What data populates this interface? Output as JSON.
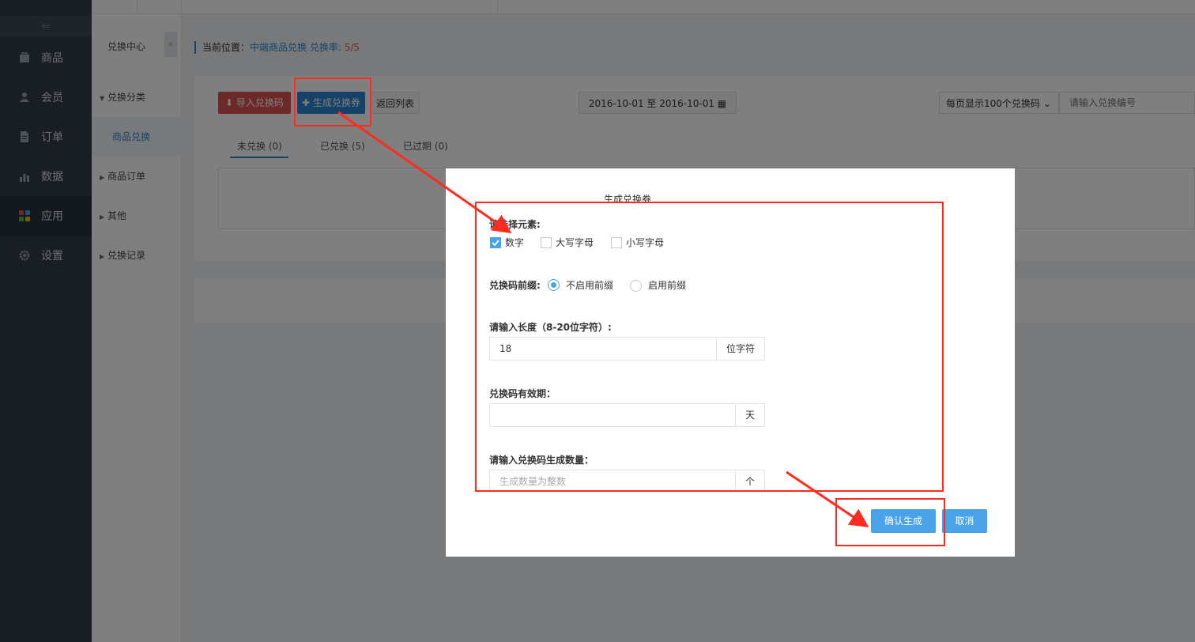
{
  "sidebar": {
    "toggle_glyph": "⇐",
    "items": [
      {
        "label": "商品",
        "icon": "bag-icon"
      },
      {
        "label": "会员",
        "icon": "user-icon"
      },
      {
        "label": "订单",
        "icon": "document-icon"
      },
      {
        "label": "数据",
        "icon": "bar-chart-icon"
      },
      {
        "label": "应用",
        "icon": "apps-icon"
      },
      {
        "label": "设置",
        "icon": "gear-icon"
      }
    ],
    "active_index": 4
  },
  "subnav": {
    "title": "兑换中心",
    "items": [
      {
        "label": "兑换分类"
      },
      {
        "label": "商品兑换"
      },
      {
        "label": "商品订单"
      },
      {
        "label": "其他"
      },
      {
        "label": "兑换记录"
      }
    ]
  },
  "breadcrumb": {
    "prefix": "当前位置：",
    "path": "中端商品兑换 兑换率:",
    "rate": "5/5"
  },
  "toolbar": {
    "import_label": "导入兑换码",
    "generate_label": "生成兑换券",
    "back_label": "返回列表",
    "date_range": "2016-10-01 至 2016-10-01",
    "per_page": "每页显示100个兑换码",
    "search_placeholder": "请输入兑换编号"
  },
  "tabs": [
    {
      "label": "未兑换 (0)"
    },
    {
      "label": "已兑换 (5)"
    },
    {
      "label": "已过期 (0)"
    }
  ],
  "modal": {
    "title": "生成兑换券",
    "elements_label": "请选择元素:",
    "elements": [
      {
        "label": "数字",
        "checked": true
      },
      {
        "label": "大写字母",
        "checked": false
      },
      {
        "label": "小写字母",
        "checked": false
      }
    ],
    "prefix_label": "兑换码前缀:",
    "prefix_options": [
      {
        "label": "不启用前缀",
        "selected": true
      },
      {
        "label": "启用前缀",
        "selected": false
      }
    ],
    "length_label": "请输入长度（8-20位字符）:",
    "length_value": "18",
    "length_unit": "位字符",
    "validity_label": "兑换码有效期：",
    "validity_value": "",
    "validity_unit": "天",
    "count_label": "请输入兑换码生成数量：",
    "count_placeholder": "生成数量为整数",
    "count_unit": "个",
    "confirm_label": "确认生成",
    "cancel_label": "取消"
  },
  "colors": {
    "sidebar_bg": "#333b48",
    "accent": "#2e84d0",
    "danger": "#d9534f",
    "modal_button": "#4aa3e8",
    "annotation": "#ff2b1f"
  }
}
